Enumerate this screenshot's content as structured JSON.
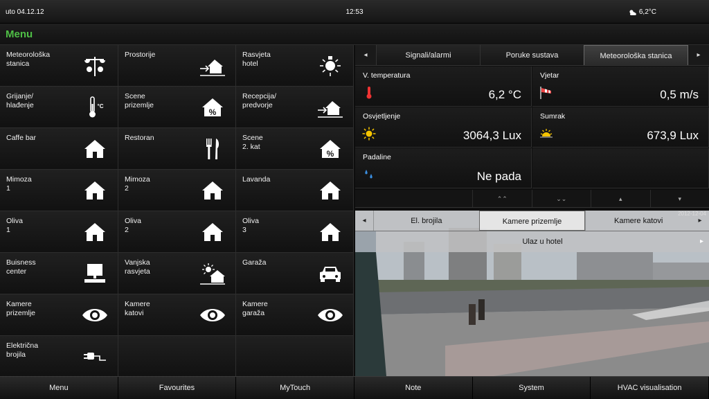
{
  "status": {
    "date": "uto 04.12.12",
    "time": "12:53",
    "temperature": "6,2°C"
  },
  "menu_header": {
    "title": "Menu"
  },
  "menu_tiles": [
    {
      "label": "Meteorološka\nstanica",
      "icon": "weather-station-icon"
    },
    {
      "label": "Prostorije",
      "icon": "enter-house-icon"
    },
    {
      "label": "Rasvjeta\nhotel",
      "icon": "lightbulb-icon"
    },
    {
      "label": "Grijanje/\nhlađenje",
      "icon": "thermometer-icon",
      "icon_text": "°C"
    },
    {
      "label": "Scene\nprizemlje",
      "icon": "house-percent-icon",
      "icon_text": "%"
    },
    {
      "label": "Recepcija/\npredvorje",
      "icon": "enter-house-icon"
    },
    {
      "label": "Caffe bar",
      "icon": "house-icon"
    },
    {
      "label": "Restoran",
      "icon": "cutlery-icon"
    },
    {
      "label": "Scene\n2. kat",
      "icon": "house-percent-icon",
      "icon_text": "%"
    },
    {
      "label": "Mimoza\n1",
      "icon": "house-icon"
    },
    {
      "label": "Mimoza\n2",
      "icon": "house-icon"
    },
    {
      "label": "Lavanda",
      "icon": "house-icon"
    },
    {
      "label": "Oliva\n1",
      "icon": "house-icon"
    },
    {
      "label": "Oliva\n2",
      "icon": "house-icon"
    },
    {
      "label": "Oliva\n3",
      "icon": "house-icon"
    },
    {
      "label": "Buisness\ncenter",
      "icon": "computer-icon"
    },
    {
      "label": "Vanjska\nrasvjeta",
      "icon": "sun-house-icon"
    },
    {
      "label": "Garaža",
      "icon": "car-icon"
    },
    {
      "label": "Kamere\nprizemlje",
      "icon": "eye-icon"
    },
    {
      "label": "Kamere\nkatovi",
      "icon": "eye-icon"
    },
    {
      "label": "Kamere\ngaraža",
      "icon": "eye-icon"
    },
    {
      "label": "Električna\nbrojila",
      "icon": "plug-icon"
    }
  ],
  "info_tabs": [
    "Signali/alarmi",
    "Poruke sustava",
    "Meteorološka stanica"
  ],
  "info_tab_active": 2,
  "meteo": {
    "temperature": {
      "label": "V. temperatura",
      "value": "6,2 °C",
      "icon": "thermometer-icon"
    },
    "wind": {
      "label": "Vjetar",
      "value": "0,5 m/s",
      "icon": "windsock-icon"
    },
    "illumination": {
      "label": "Osvjetljenje",
      "value": "3064,3 Lux",
      "icon": "sun-icon"
    },
    "dusk": {
      "label": "Sumrak",
      "value": "673,9 Lux",
      "icon": "sunset-icon"
    },
    "rain": {
      "label": "Padaline",
      "value": "Ne pada",
      "icon": "raindrops-icon"
    }
  },
  "meteo_nav": [
    "double-up-icon",
    "double-down-icon",
    "up-icon",
    "down-icon"
  ],
  "camera": {
    "tabs": [
      "El. brojila",
      "Kamere prizemlje",
      "Kamere katovi"
    ],
    "active_tab": 1,
    "sub_label": "Ulaz u hotel",
    "stamp": "2012-12-04"
  },
  "bottom_nav": [
    "Menu",
    "Favourites",
    "MyTouch",
    "Note",
    "System",
    "HVAC visualisation"
  ]
}
